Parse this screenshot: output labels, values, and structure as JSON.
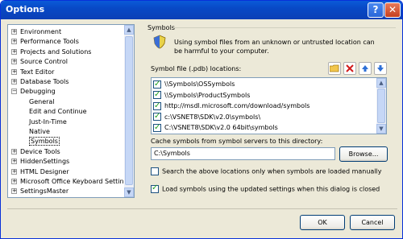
{
  "window": {
    "title": "Options",
    "help_label": "?",
    "close_label": "✕"
  },
  "tree": {
    "items": [
      {
        "label": "Environment",
        "exp": "+"
      },
      {
        "label": "Performance Tools",
        "exp": "+"
      },
      {
        "label": "Projects and Solutions",
        "exp": "+"
      },
      {
        "label": "Source Control",
        "exp": "+"
      },
      {
        "label": "Text Editor",
        "exp": "+"
      },
      {
        "label": "Database Tools",
        "exp": "+"
      },
      {
        "label": "Debugging",
        "exp": "−"
      },
      {
        "label": "General",
        "exp": ""
      },
      {
        "label": "Edit and Continue",
        "exp": ""
      },
      {
        "label": "Just-In-Time",
        "exp": ""
      },
      {
        "label": "Native",
        "exp": ""
      },
      {
        "label": "Symbols",
        "exp": ""
      },
      {
        "label": "Device Tools",
        "exp": "+"
      },
      {
        "label": "HiddenSettings",
        "exp": "+"
      },
      {
        "label": "HTML Designer",
        "exp": "+"
      },
      {
        "label": "Microsoft Office Keyboard Settings",
        "exp": "+"
      },
      {
        "label": "SettingsMaster",
        "exp": "+"
      }
    ],
    "selected": "Symbols",
    "scroll_up": "▲",
    "scroll_down": "▼"
  },
  "symbols": {
    "section_title": "Symbols",
    "warning": "Using symbol files from an unknown or untrusted location can be harmful to your computer.",
    "file_locations_label": "Symbol file (.pdb) locations:",
    "locations": [
      {
        "path": "\\\\Symbols\\OSSymbols",
        "checked": true
      },
      {
        "path": "\\\\Symbols\\ProductSymbols",
        "checked": true
      },
      {
        "path": "http://msdl.microsoft.com/download/symbols",
        "checked": true
      },
      {
        "path": "c:\\VSNET8\\SDK\\v2.0\\symbols\\",
        "checked": true
      },
      {
        "path": "C:\\VSNET8\\SDK\\v2.0 64bit\\symbols",
        "checked": true
      }
    ],
    "cache_label": "Cache symbols from symbol servers to this directory:",
    "cache_path": "C:\\Symbols",
    "browse_label": "Browse...",
    "search_only_label": "Search the above locations only when symbols are loaded manually",
    "search_only_checked": false,
    "load_updated_label": "Load symbols using the updated settings when this dialog is closed",
    "load_updated_checked": true
  },
  "toolbar": {
    "folder_icon": "folder-icon",
    "delete_icon": "delete-icon",
    "up_icon": "arrow-up-icon",
    "down_icon": "arrow-down-icon"
  },
  "footer": {
    "ok_label": "OK",
    "cancel_label": "Cancel"
  },
  "colors": {
    "title_bar": "#0a5ad8",
    "delete_red": "#d21a1a",
    "arrow_blue": "#2d6fd6",
    "folder_yellow": "#f2c64d"
  }
}
